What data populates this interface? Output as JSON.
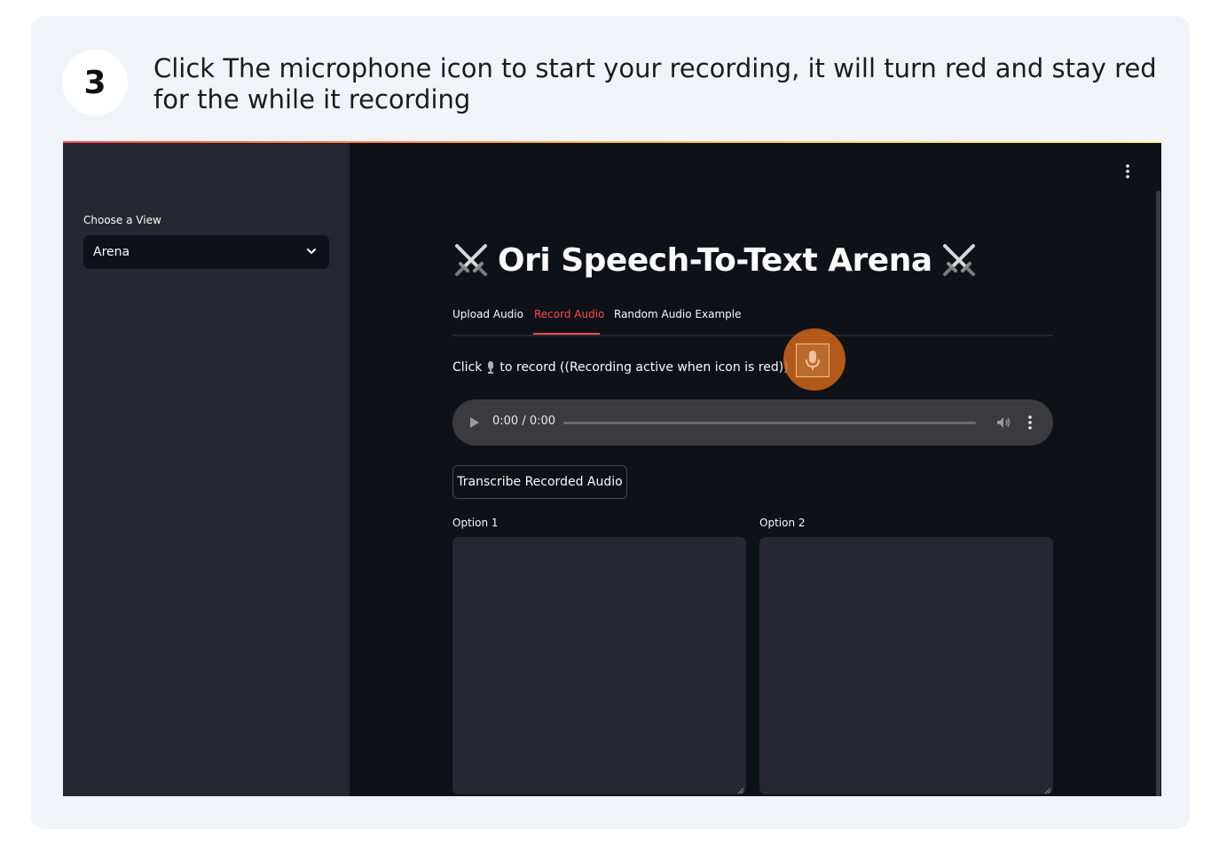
{
  "step": {
    "number": "3",
    "text": "Click The microphone icon to start your recording, it will turn red and stay red for the while it recording"
  },
  "app": {
    "sidebar": {
      "label": "Choose a View",
      "select_value": "Arena"
    },
    "title": "Ori Speech-To-Text Arena",
    "tabs": [
      {
        "label": "Upload Audio",
        "active": false
      },
      {
        "label": "Record Audio",
        "active": true
      },
      {
        "label": "Random Audio Example",
        "active": false
      }
    ],
    "instruction_prefix": "Click",
    "instruction_suffix": "to record ((Recording active when icon is red))",
    "player": {
      "time": "0:00 / 0:00"
    },
    "transcribe_button": "Transcribe Recorded Audio",
    "options": [
      {
        "label": "Option 1",
        "value": ""
      },
      {
        "label": "Option 2",
        "value": ""
      }
    ],
    "colors": {
      "accent": "#ff4b4b",
      "highlight": "#e06e1a",
      "background": "#0e1117",
      "sidebar": "#262730"
    }
  }
}
